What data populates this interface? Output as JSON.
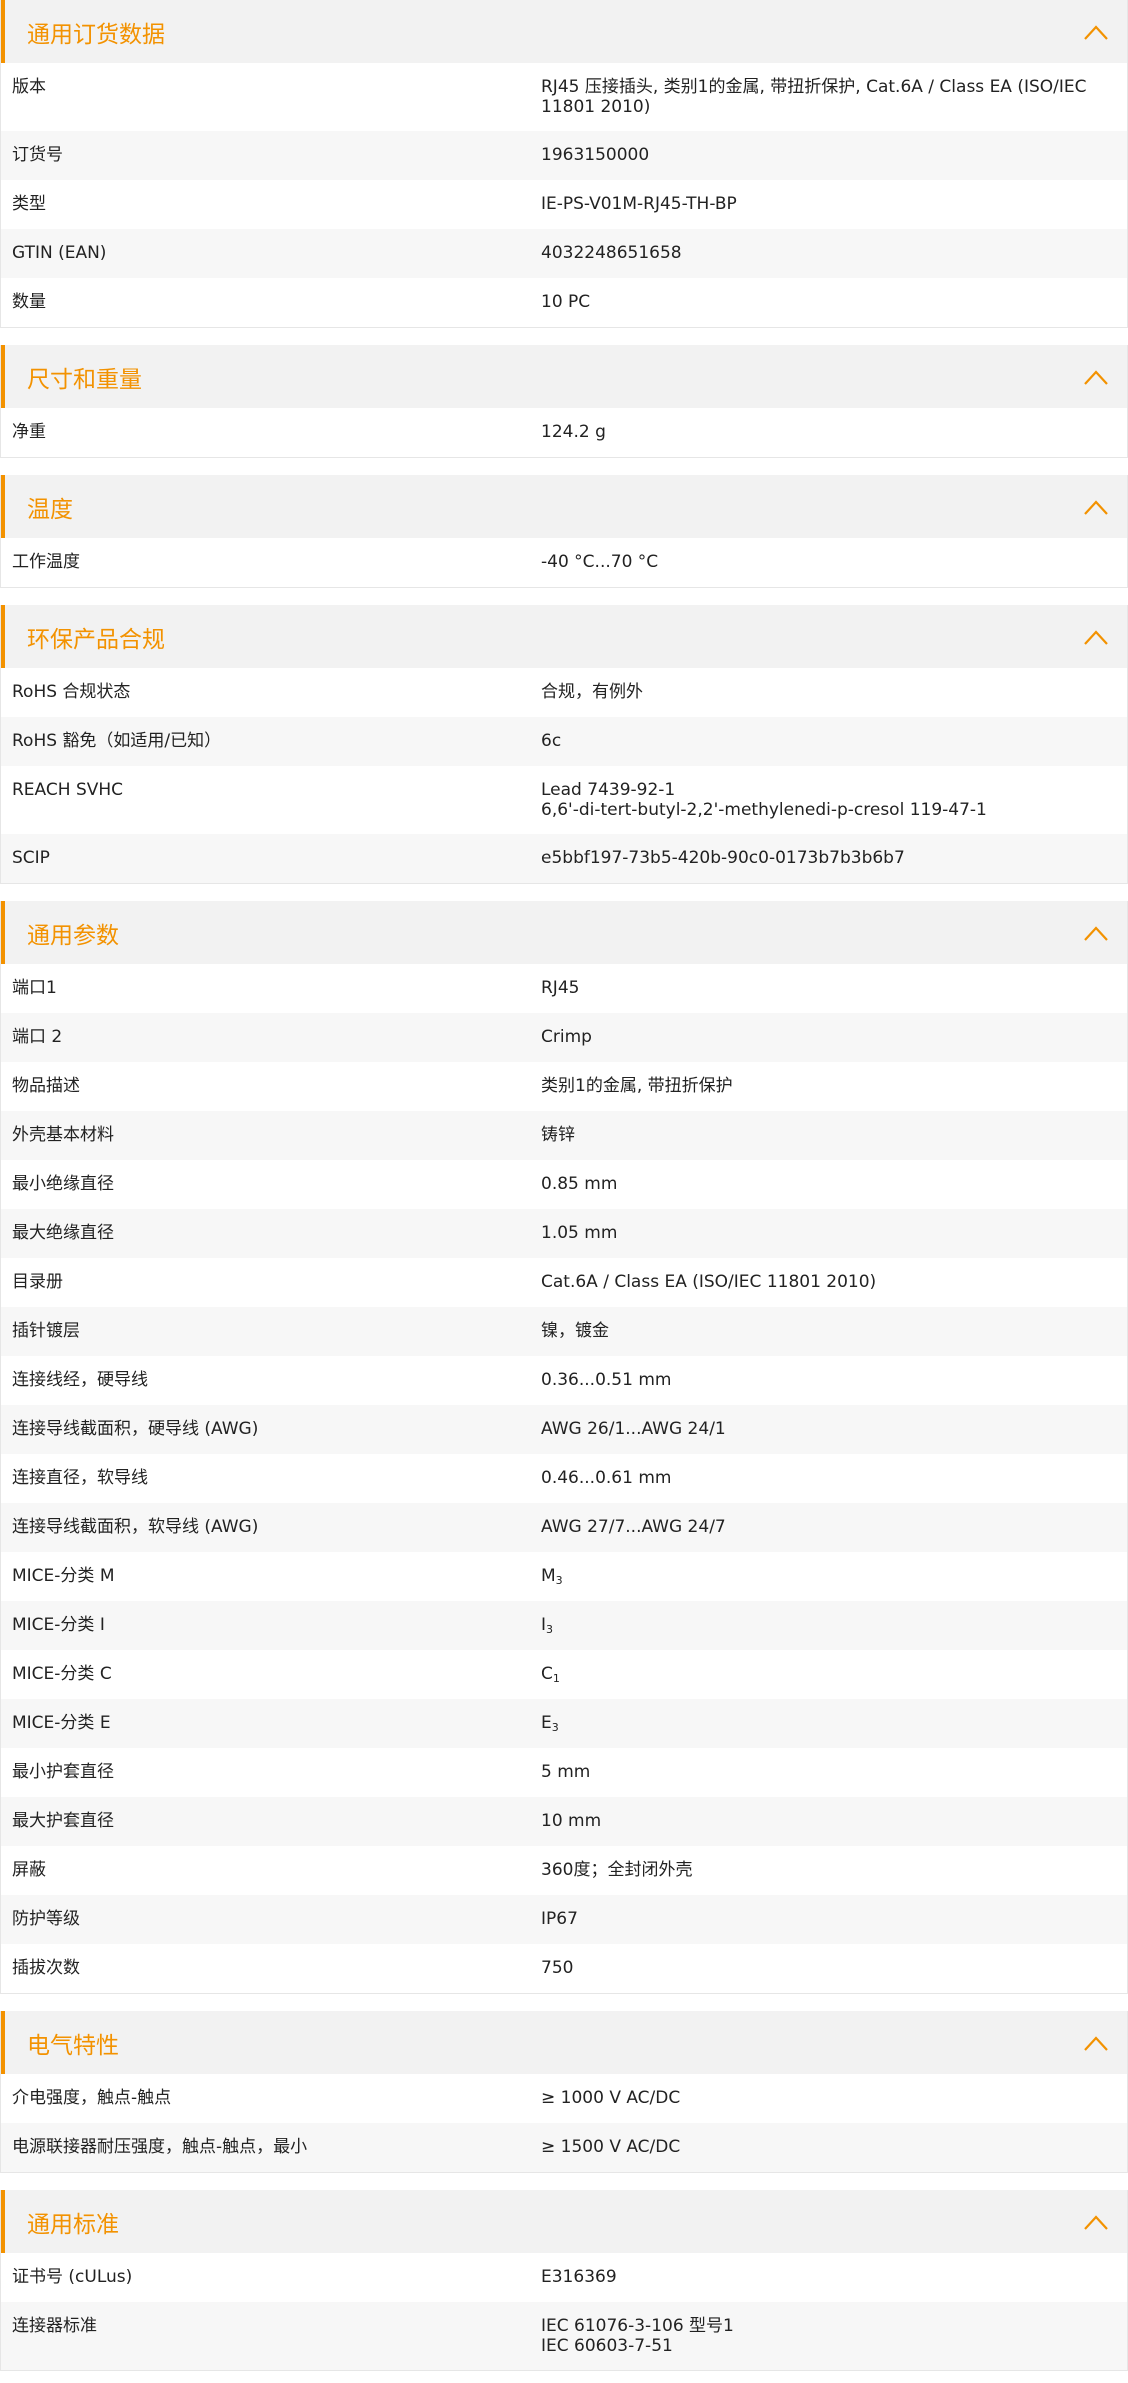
{
  "colors": {
    "accent": "#f39200",
    "header_bg": "#f2f2f2",
    "row_alt_bg": "#f7f7f7"
  },
  "icons": {
    "section_toggle": "chevron-up-icon"
  },
  "sections": [
    {
      "title": "通用订货数据",
      "rows": [
        {
          "label": "版本",
          "value": "RJ45 压接插头, 类别1的金属, 带扭折保护, Cat.6A / Class EA (ISO/IEC 11801 2010)"
        },
        {
          "label": "订货号",
          "value": "1963150000"
        },
        {
          "label": "类型",
          "value": "IE-PS-V01M-RJ45-TH-BP"
        },
        {
          "label": "GTIN (EAN)",
          "value": "4032248651658"
        },
        {
          "label": "数量",
          "value": "10  PC"
        }
      ]
    },
    {
      "title": "尺寸和重量",
      "rows": [
        {
          "label": "净重",
          "value": "124.2  g"
        }
      ]
    },
    {
      "title": "温度",
      "rows": [
        {
          "label": "工作温度",
          "value": "-40 °C...70 °C"
        }
      ]
    },
    {
      "title": "环保产品合规",
      "rows": [
        {
          "label": "RoHS 合规状态",
          "value": "合规，有例外"
        },
        {
          "label": "RoHS 豁免（如适用/已知）",
          "value": "6c"
        },
        {
          "label": "REACH SVHC",
          "lines": [
            "Lead 7439-92-1",
            "6,6'-di-tert-butyl-2,2'-methylenedi-p-cresol 119-47-1"
          ]
        },
        {
          "label": "SCIP",
          "value": "e5bbf197-73b5-420b-90c0-0173b7b3b6b7"
        }
      ]
    },
    {
      "title": "通用参数",
      "rows": [
        {
          "label": "端口1",
          "value": "RJ45"
        },
        {
          "label": "端口 2",
          "value": "Crimp"
        },
        {
          "label": "物品描述",
          "value": "类别1的金属, 带扭折保护"
        },
        {
          "label": "外壳基本材料",
          "value": "铸锌"
        },
        {
          "label": "最小绝缘直径",
          "value": "0.85  mm"
        },
        {
          "label": "最大绝缘直径",
          "value": "1.05  mm"
        },
        {
          "label": "目录册",
          "value": "Cat.6A / Class EA (ISO/IEC 11801 2010)"
        },
        {
          "label": "插针镀层",
          "value": "镍，镀金"
        },
        {
          "label": "连接线经，硬导线",
          "value": "0.36...0.51 mm"
        },
        {
          "label": "连接导线截面积，硬导线 (AWG)",
          "value": "AWG 26/1...AWG 24/1"
        },
        {
          "label": "连接直径，软导线",
          "value": "0.46...0.61 mm"
        },
        {
          "label": "连接导线截面积，软导线 (AWG)",
          "value": "AWG 27/7...AWG 24/7"
        },
        {
          "label": "MICE-分类 M",
          "value": "M",
          "sub": "3"
        },
        {
          "label": "MICE-分类 I",
          "value": "I",
          "sub": "3"
        },
        {
          "label": "MICE-分类 C",
          "value": "C",
          "sub": "1"
        },
        {
          "label": "MICE-分类 E",
          "value": "E",
          "sub": "3"
        },
        {
          "label": "最小护套直径",
          "value": "5  mm"
        },
        {
          "label": "最大护套直径",
          "value": "10  mm"
        },
        {
          "label": "屏蔽",
          "value": "360度；全封闭外壳"
        },
        {
          "label": "防护等级",
          "value": "IP67"
        },
        {
          "label": "插拔次数",
          "value": "750"
        }
      ]
    },
    {
      "title": "电气特性",
      "rows": [
        {
          "label": "介电强度，触点-触点",
          "value": "≥ 1000 V AC/DC"
        },
        {
          "label": "电源联接器耐压强度，触点-触点，最小",
          "value": "≥ 1500 V AC/DC"
        }
      ]
    },
    {
      "title": "通用标准",
      "rows": [
        {
          "label": "证书号 (cULus)",
          "value": "E316369"
        },
        {
          "label": "连接器标准",
          "lines": [
            "IEC 61076-3-106 型号1",
            "IEC 60603-7-51"
          ]
        }
      ]
    }
  ]
}
